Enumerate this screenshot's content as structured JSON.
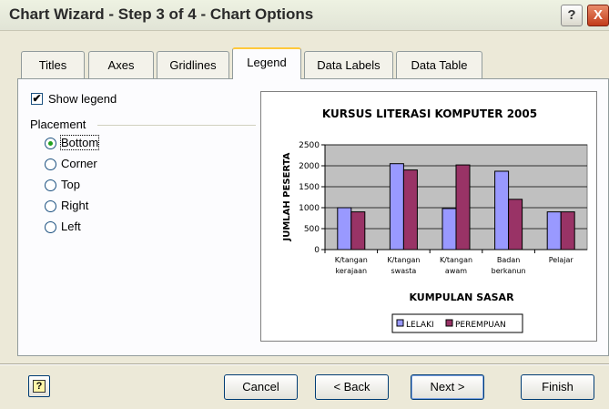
{
  "window": {
    "title": "Chart Wizard - Step 3 of 4 - Chart Options",
    "help_glyph": "?",
    "close_glyph": "X"
  },
  "tabs": [
    {
      "label": "Titles"
    },
    {
      "label": "Axes"
    },
    {
      "label": "Gridlines"
    },
    {
      "label": "Legend",
      "active": true
    },
    {
      "label": "Data Labels"
    },
    {
      "label": "Data Table"
    }
  ],
  "legend_options": {
    "show_legend_label": "Show legend",
    "show_legend_checked": true,
    "checkmark": "✔",
    "placement_label": "Placement",
    "placements": [
      {
        "label": "Bottom",
        "selected": true
      },
      {
        "label": "Corner",
        "selected": false
      },
      {
        "label": "Top",
        "selected": false
      },
      {
        "label": "Right",
        "selected": false
      },
      {
        "label": "Left",
        "selected": false
      }
    ]
  },
  "buttons": {
    "help_icon": "?",
    "cancel": "Cancel",
    "back": "< Back",
    "next": "Next >",
    "finish": "Finish"
  },
  "colors": {
    "series1": "#9999FF",
    "series2": "#993366",
    "plot_area": "#C0C0C0",
    "accent_tab": "#FFC83C"
  },
  "chart_data": {
    "type": "bar",
    "title": "KURSUS LITERASI KOMPUTER 2005",
    "xlabel": "KUMPULAN SASAR",
    "ylabel": "JUMLAH PESERTA",
    "categories": [
      [
        "K/tangan",
        "kerajaan"
      ],
      [
        "K/tangan",
        "swasta"
      ],
      [
        "K/tangan",
        "awam"
      ],
      [
        "Badan",
        "berkanun"
      ],
      [
        "Pelajar"
      ]
    ],
    "series": [
      {
        "name": "LELAKI",
        "values": [
          1000,
          2050,
          980,
          1870,
          900
        ]
      },
      {
        "name": "PEREMPUAN",
        "values": [
          900,
          1900,
          2020,
          1200,
          900
        ]
      }
    ],
    "ylim": [
      0,
      2500
    ],
    "yticks": [
      "0",
      "500",
      "1000",
      "1500",
      "2000",
      "2500"
    ],
    "grid": true,
    "legend_position": "bottom"
  }
}
